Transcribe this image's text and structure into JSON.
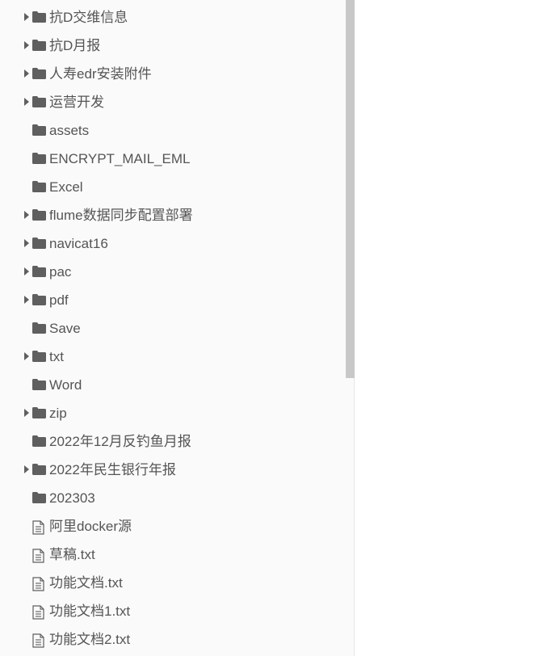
{
  "tree": [
    {
      "label": "抗D交维信息",
      "type": "folder",
      "expandable": true
    },
    {
      "label": "抗D月报",
      "type": "folder",
      "expandable": true
    },
    {
      "label": "人寿edr安装附件",
      "type": "folder",
      "expandable": true
    },
    {
      "label": "运营开发",
      "type": "folder",
      "expandable": true
    },
    {
      "label": "assets",
      "type": "folder",
      "expandable": false
    },
    {
      "label": "ENCRYPT_MAIL_EML",
      "type": "folder",
      "expandable": false
    },
    {
      "label": "Excel",
      "type": "folder",
      "expandable": false
    },
    {
      "label": "flume数据同步配置部署",
      "type": "folder",
      "expandable": true
    },
    {
      "label": "navicat16",
      "type": "folder",
      "expandable": true
    },
    {
      "label": "pac",
      "type": "folder",
      "expandable": true
    },
    {
      "label": "pdf",
      "type": "folder",
      "expandable": true
    },
    {
      "label": "Save",
      "type": "folder",
      "expandable": false
    },
    {
      "label": "txt",
      "type": "folder",
      "expandable": true
    },
    {
      "label": "Word",
      "type": "folder",
      "expandable": false
    },
    {
      "label": "zip",
      "type": "folder",
      "expandable": true
    },
    {
      "label": "2022年12月反钓鱼月报",
      "type": "folder",
      "expandable": false
    },
    {
      "label": "2022年民生银行年报",
      "type": "folder",
      "expandable": true
    },
    {
      "label": "202303",
      "type": "folder",
      "expandable": false
    },
    {
      "label": "阿里docker源",
      "type": "file",
      "expandable": false
    },
    {
      "label": "草稿.txt",
      "type": "file",
      "expandable": false
    },
    {
      "label": "功能文档.txt",
      "type": "file",
      "expandable": false
    },
    {
      "label": "功能文档1.txt",
      "type": "file",
      "expandable": false
    },
    {
      "label": "功能文档2.txt",
      "type": "file",
      "expandable": false
    }
  ],
  "icons": {
    "folder": "folder-icon",
    "file": "file-text-icon",
    "caret": "caret-right-icon"
  },
  "colors": {
    "icon": "#5f5f5f",
    "text": "#555555",
    "sidebar_bg": "#fafafa",
    "scrollbar": "#c8c8c8"
  }
}
